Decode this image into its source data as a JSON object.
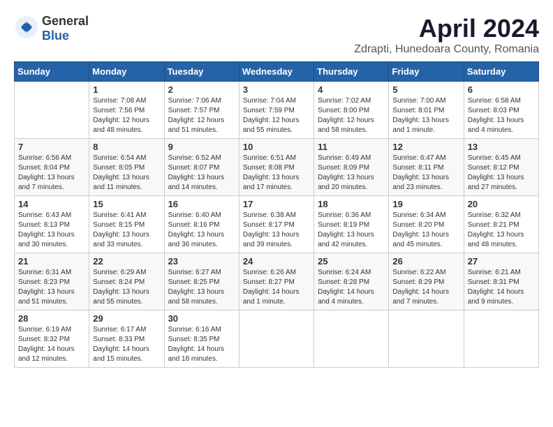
{
  "header": {
    "logo_general": "General",
    "logo_blue": "Blue",
    "month_title": "April 2024",
    "location": "Zdrapti, Hunedoara County, Romania"
  },
  "columns": [
    "Sunday",
    "Monday",
    "Tuesday",
    "Wednesday",
    "Thursday",
    "Friday",
    "Saturday"
  ],
  "weeks": [
    [
      {
        "day": "",
        "sunrise": "",
        "sunset": "",
        "daylight": ""
      },
      {
        "day": "1",
        "sunrise": "Sunrise: 7:08 AM",
        "sunset": "Sunset: 7:56 PM",
        "daylight": "Daylight: 12 hours and 48 minutes."
      },
      {
        "day": "2",
        "sunrise": "Sunrise: 7:06 AM",
        "sunset": "Sunset: 7:57 PM",
        "daylight": "Daylight: 12 hours and 51 minutes."
      },
      {
        "day": "3",
        "sunrise": "Sunrise: 7:04 AM",
        "sunset": "Sunset: 7:59 PM",
        "daylight": "Daylight: 12 hours and 55 minutes."
      },
      {
        "day": "4",
        "sunrise": "Sunrise: 7:02 AM",
        "sunset": "Sunset: 8:00 PM",
        "daylight": "Daylight: 12 hours and 58 minutes."
      },
      {
        "day": "5",
        "sunrise": "Sunrise: 7:00 AM",
        "sunset": "Sunset: 8:01 PM",
        "daylight": "Daylight: 13 hours and 1 minute."
      },
      {
        "day": "6",
        "sunrise": "Sunrise: 6:58 AM",
        "sunset": "Sunset: 8:03 PM",
        "daylight": "Daylight: 13 hours and 4 minutes."
      }
    ],
    [
      {
        "day": "7",
        "sunrise": "Sunrise: 6:56 AM",
        "sunset": "Sunset: 8:04 PM",
        "daylight": "Daylight: 13 hours and 7 minutes."
      },
      {
        "day": "8",
        "sunrise": "Sunrise: 6:54 AM",
        "sunset": "Sunset: 8:05 PM",
        "daylight": "Daylight: 13 hours and 11 minutes."
      },
      {
        "day": "9",
        "sunrise": "Sunrise: 6:52 AM",
        "sunset": "Sunset: 8:07 PM",
        "daylight": "Daylight: 13 hours and 14 minutes."
      },
      {
        "day": "10",
        "sunrise": "Sunrise: 6:51 AM",
        "sunset": "Sunset: 8:08 PM",
        "daylight": "Daylight: 13 hours and 17 minutes."
      },
      {
        "day": "11",
        "sunrise": "Sunrise: 6:49 AM",
        "sunset": "Sunset: 8:09 PM",
        "daylight": "Daylight: 13 hours and 20 minutes."
      },
      {
        "day": "12",
        "sunrise": "Sunrise: 6:47 AM",
        "sunset": "Sunset: 8:11 PM",
        "daylight": "Daylight: 13 hours and 23 minutes."
      },
      {
        "day": "13",
        "sunrise": "Sunrise: 6:45 AM",
        "sunset": "Sunset: 8:12 PM",
        "daylight": "Daylight: 13 hours and 27 minutes."
      }
    ],
    [
      {
        "day": "14",
        "sunrise": "Sunrise: 6:43 AM",
        "sunset": "Sunset: 8:13 PM",
        "daylight": "Daylight: 13 hours and 30 minutes."
      },
      {
        "day": "15",
        "sunrise": "Sunrise: 6:41 AM",
        "sunset": "Sunset: 8:15 PM",
        "daylight": "Daylight: 13 hours and 33 minutes."
      },
      {
        "day": "16",
        "sunrise": "Sunrise: 6:40 AM",
        "sunset": "Sunset: 8:16 PM",
        "daylight": "Daylight: 13 hours and 36 minutes."
      },
      {
        "day": "17",
        "sunrise": "Sunrise: 6:38 AM",
        "sunset": "Sunset: 8:17 PM",
        "daylight": "Daylight: 13 hours and 39 minutes."
      },
      {
        "day": "18",
        "sunrise": "Sunrise: 6:36 AM",
        "sunset": "Sunset: 8:19 PM",
        "daylight": "Daylight: 13 hours and 42 minutes."
      },
      {
        "day": "19",
        "sunrise": "Sunrise: 6:34 AM",
        "sunset": "Sunset: 8:20 PM",
        "daylight": "Daylight: 13 hours and 45 minutes."
      },
      {
        "day": "20",
        "sunrise": "Sunrise: 6:32 AM",
        "sunset": "Sunset: 8:21 PM",
        "daylight": "Daylight: 13 hours and 48 minutes."
      }
    ],
    [
      {
        "day": "21",
        "sunrise": "Sunrise: 6:31 AM",
        "sunset": "Sunset: 8:23 PM",
        "daylight": "Daylight: 13 hours and 51 minutes."
      },
      {
        "day": "22",
        "sunrise": "Sunrise: 6:29 AM",
        "sunset": "Sunset: 8:24 PM",
        "daylight": "Daylight: 13 hours and 55 minutes."
      },
      {
        "day": "23",
        "sunrise": "Sunrise: 6:27 AM",
        "sunset": "Sunset: 8:25 PM",
        "daylight": "Daylight: 13 hours and 58 minutes."
      },
      {
        "day": "24",
        "sunrise": "Sunrise: 6:26 AM",
        "sunset": "Sunset: 8:27 PM",
        "daylight": "Daylight: 14 hours and 1 minute."
      },
      {
        "day": "25",
        "sunrise": "Sunrise: 6:24 AM",
        "sunset": "Sunset: 8:28 PM",
        "daylight": "Daylight: 14 hours and 4 minutes."
      },
      {
        "day": "26",
        "sunrise": "Sunrise: 6:22 AM",
        "sunset": "Sunset: 8:29 PM",
        "daylight": "Daylight: 14 hours and 7 minutes."
      },
      {
        "day": "27",
        "sunrise": "Sunrise: 6:21 AM",
        "sunset": "Sunset: 8:31 PM",
        "daylight": "Daylight: 14 hours and 9 minutes."
      }
    ],
    [
      {
        "day": "28",
        "sunrise": "Sunrise: 6:19 AM",
        "sunset": "Sunset: 8:32 PM",
        "daylight": "Daylight: 14 hours and 12 minutes."
      },
      {
        "day": "29",
        "sunrise": "Sunrise: 6:17 AM",
        "sunset": "Sunset: 8:33 PM",
        "daylight": "Daylight: 14 hours and 15 minutes."
      },
      {
        "day": "30",
        "sunrise": "Sunrise: 6:16 AM",
        "sunset": "Sunset: 8:35 PM",
        "daylight": "Daylight: 14 hours and 18 minutes."
      },
      {
        "day": "",
        "sunrise": "",
        "sunset": "",
        "daylight": ""
      },
      {
        "day": "",
        "sunrise": "",
        "sunset": "",
        "daylight": ""
      },
      {
        "day": "",
        "sunrise": "",
        "sunset": "",
        "daylight": ""
      },
      {
        "day": "",
        "sunrise": "",
        "sunset": "",
        "daylight": ""
      }
    ]
  ]
}
